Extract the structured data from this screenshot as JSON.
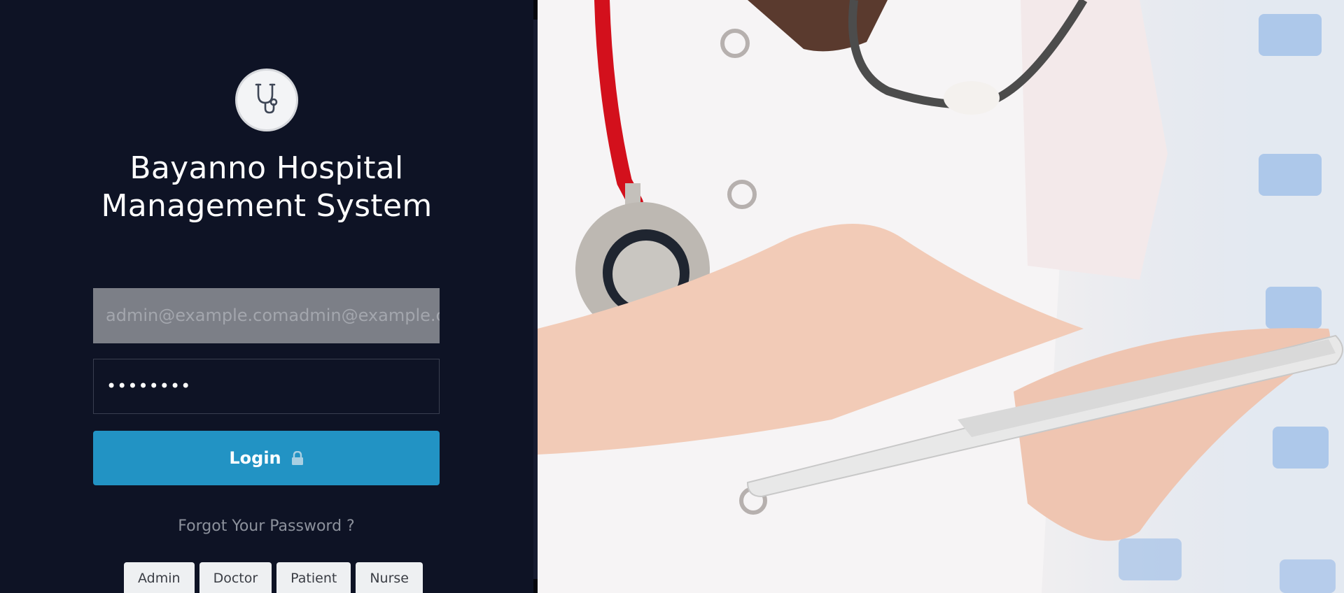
{
  "app": {
    "title_line1": "Bayanno Hospital",
    "title_line2": "Management System",
    "logo_icon": "stethoscope-icon"
  },
  "form": {
    "email_value": "admin@example.comadmin@example.c",
    "password_value": "••••••••",
    "login_label": "Login",
    "login_icon": "lock-icon",
    "forgot_label": "Forgot Your Password ?"
  },
  "roles": [
    {
      "label": "Admin"
    },
    {
      "label": "Doctor"
    },
    {
      "label": "Patient"
    },
    {
      "label": "Nurse"
    }
  ],
  "colors": {
    "panel_bg": "#0e1325",
    "accent": "#2293c4"
  }
}
